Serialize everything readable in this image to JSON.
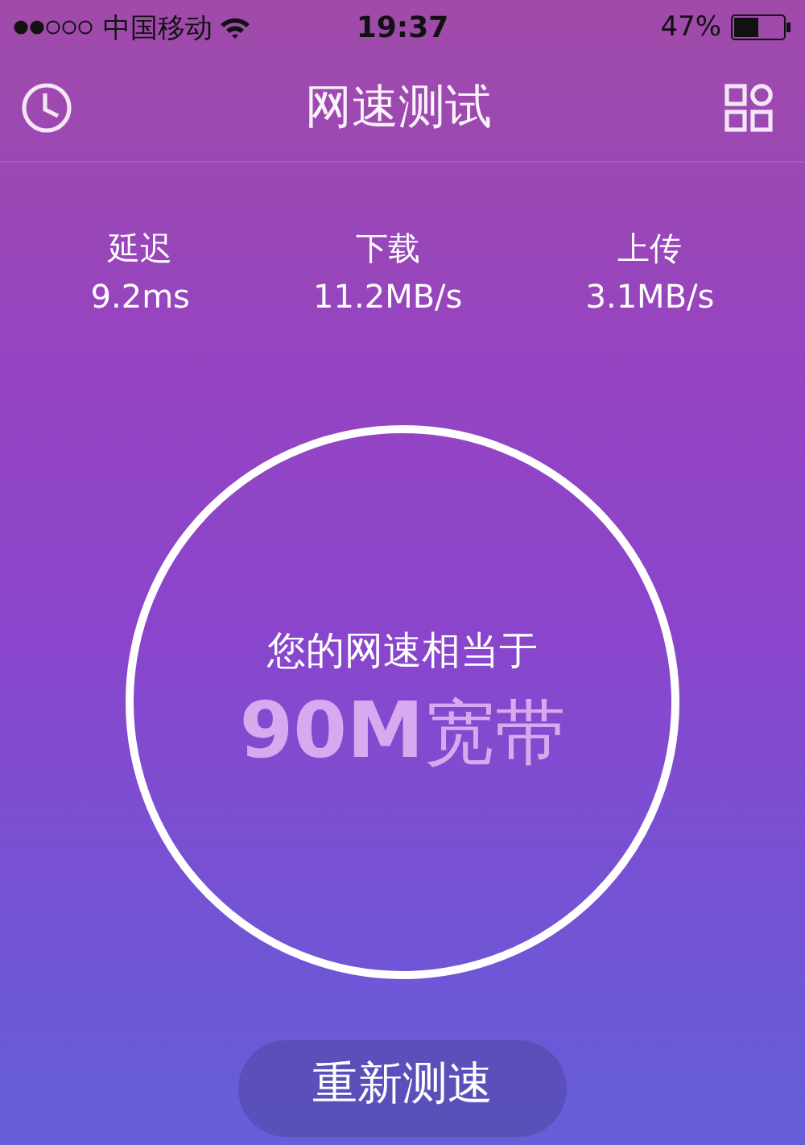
{
  "status_bar": {
    "carrier": "中国移动",
    "time": "19:37",
    "battery": "47%"
  },
  "nav_bar": {
    "title": "网速测试"
  },
  "stats": [
    {
      "label": "延迟",
      "value": "9.2ms"
    },
    {
      "label": "下载",
      "value": "11.2MB/s"
    },
    {
      "label": "上传",
      "value": "3.1MB/s"
    }
  ],
  "result": {
    "caption": "您的网速相当于",
    "speed": "90M",
    "unit": "宽带"
  },
  "buttons": [
    "重新测速"
  ]
}
